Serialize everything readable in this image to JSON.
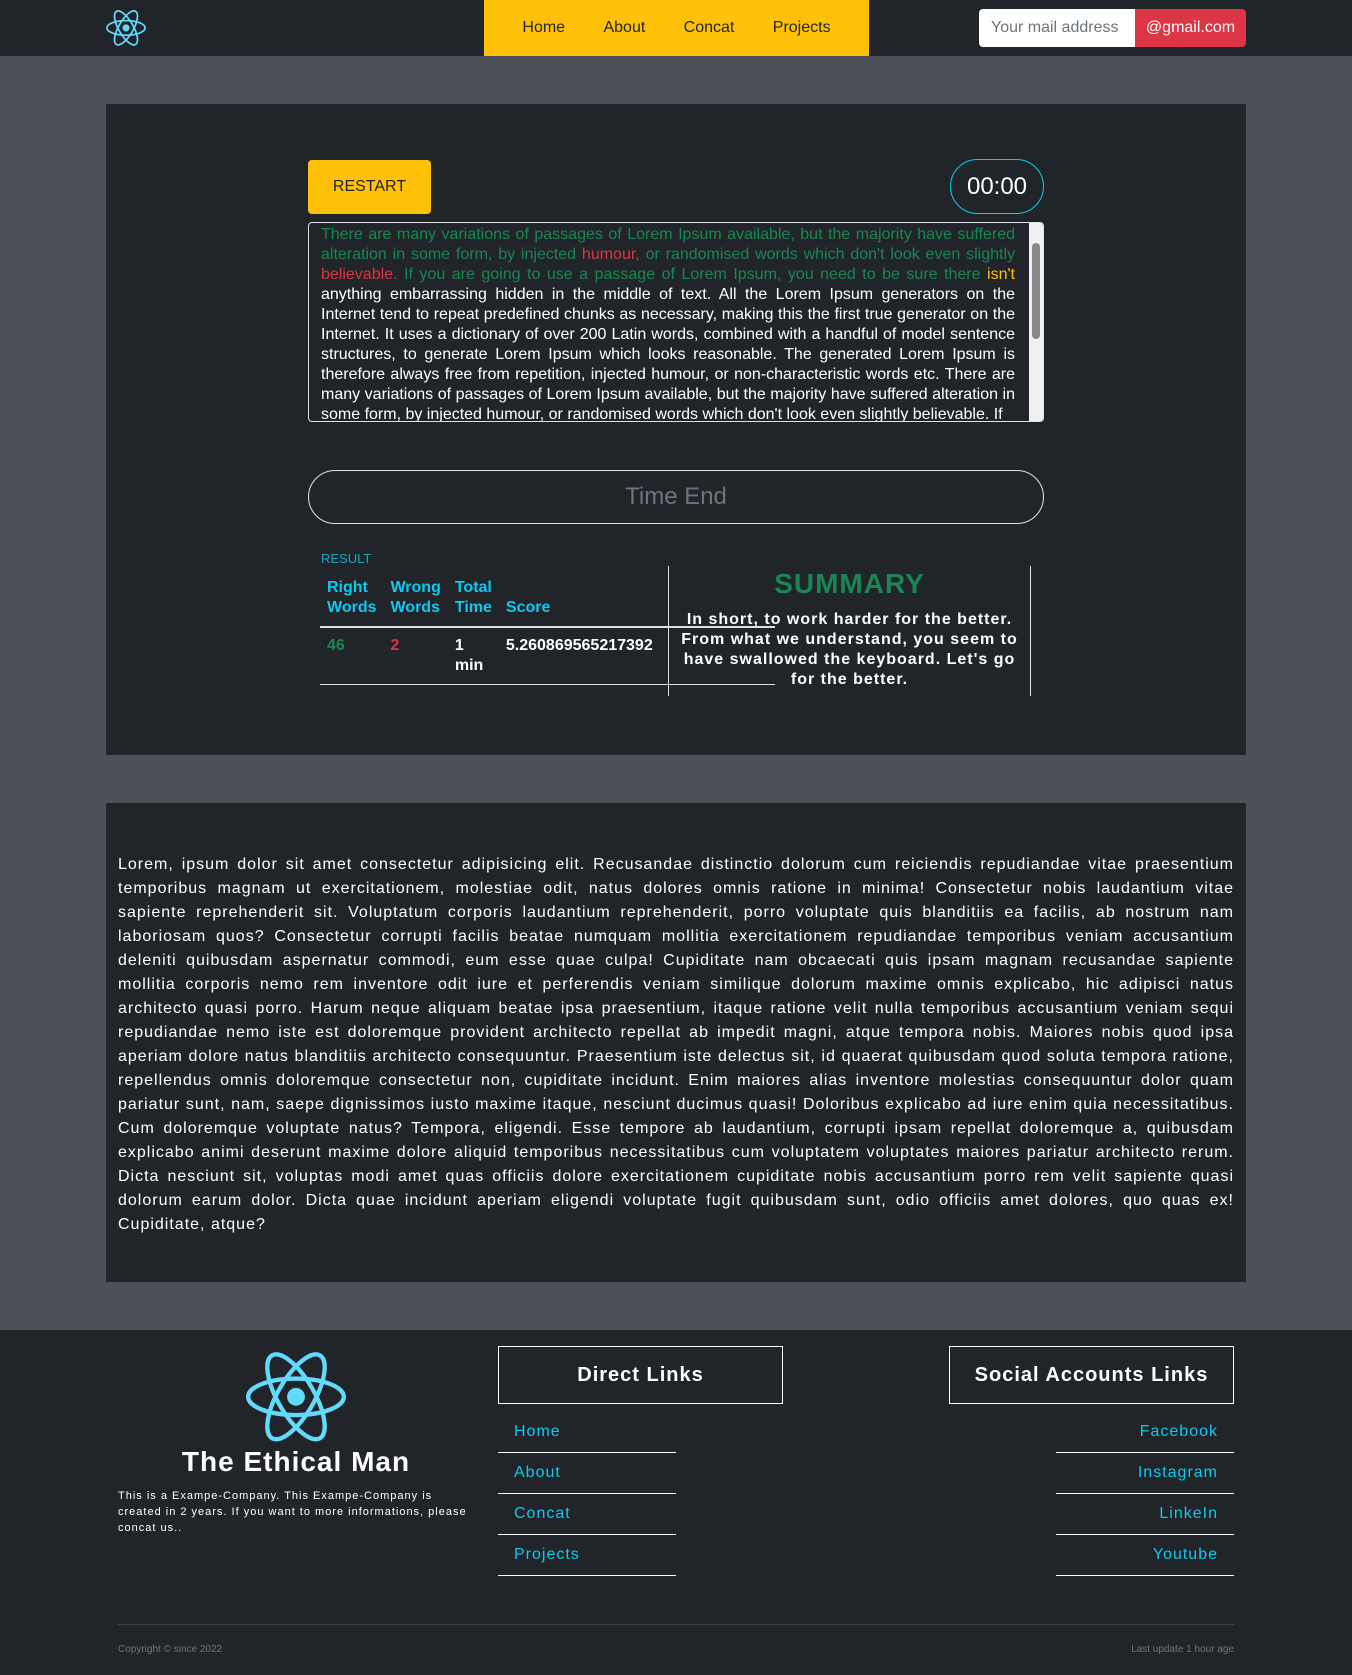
{
  "navbar": {
    "logo_icon": "react-atom-icon",
    "links": [
      "Home",
      "About",
      "Concat",
      "Projects"
    ],
    "mail_placeholder": "Your mail address",
    "mail_suffix": "@gmail.com"
  },
  "typing_test": {
    "restart_label": "RESTART",
    "timer": "00:00",
    "text_segments": {
      "typed_correct_1": "There are many variations of passages of Lorem Ipsum available, but the majority have suffered alteration in some form, by injected ",
      "typed_wrong_1": "humour,",
      "typed_correct_2": " or randomised words which don't look even slightly ",
      "typed_wrong_2": "believable.",
      "typed_correct_3": " If you are going to use a passage of Lorem Ipsum, you need to be sure there ",
      "current_word": "isn't",
      "remaining": " anything embarrassing hidden in the middle of text. All the Lorem Ipsum generators on the Internet tend to repeat predefined chunks as necessary, making this the first true generator on the Internet. It uses a dictionary of over 200 Latin words, combined with a handful of model sentence structures, to generate Lorem Ipsum which looks reasonable. The generated Lorem Ipsum is therefore always free from repetition, injected humour, or non-characteristic words etc. There are many variations of passages of Lorem Ipsum available, but the majority have suffered alteration in some form, by injected humour, or randomised words which don't look even slightly believable. If"
    },
    "input_placeholder": "Time End",
    "colors": {
      "correct": "#198754",
      "wrong": "#dc3545",
      "current": "#ffc107",
      "accent": "#0dcaf0"
    }
  },
  "result": {
    "label": "RESULT",
    "headers": {
      "right": "Right Words",
      "wrong": "Wrong Words",
      "time": "Total Time",
      "score": "Score"
    },
    "values": {
      "right": "46",
      "wrong": "2",
      "time": "1 min",
      "score": "5.260869565217392"
    }
  },
  "summary": {
    "title": "SUMMARY",
    "text": "In short, to work harder for the better. From what we understand, you seem to have swallowed the keyboard. Let's go for the better."
  },
  "lorem": {
    "text": "Lorem, ipsum dolor sit amet consectetur adipisicing elit. Recusandae distinctio dolorum cum reiciendis repudiandae vitae praesentium temporibus magnam ut exercitationem, molestiae odit, natus dolores omnis ratione in minima! Consectetur nobis laudantium vitae sapiente reprehenderit sit. Voluptatum corporis laudantium reprehenderit, porro voluptate quis blanditiis ea facilis, ab nostrum nam laboriosam quos? Consectetur corrupti facilis beatae numquam mollitia exercitationem repudiandae temporibus veniam accusantium deleniti quibusdam aspernatur commodi, eum esse quae culpa! Cupiditate nam obcaecati quis ipsam magnam recusandae sapiente mollitia corporis nemo rem inventore odit iure et perferendis veniam similique dolorum maxime omnis explicabo, hic adipisci natus architecto quasi porro. Harum neque aliquam beatae ipsa praesentium, itaque ratione velit nulla temporibus accusantium veniam sequi repudiandae nemo iste est doloremque provident architecto repellat ab impedit magni, atque tempora nobis. Maiores nobis quod ipsa aperiam dolore natus blanditiis architecto consequuntur. Praesentium iste delectus sit, id quaerat quibusdam quod soluta tempora ratione, repellendus omnis doloremque consectetur non, cupiditate incidunt. Enim maiores alias inventore molestias consequuntur dolor quam pariatur sunt, nam, saepe dignissimos iusto maxime itaque, nesciunt ducimus quasi! Doloribus explicabo ad iure enim quia necessitatibus. Cum doloremque voluptate natus? Tempora, eligendi. Esse tempore ab laudantium, corrupti ipsam repellat doloremque a, quibusdam explicabo animi deserunt maxime dolore aliquid temporibus necessitatibus cum voluptatem voluptates maiores pariatur architecto rerum. Dicta nesciunt sit, voluptas modi amet quas officiis dolore exercitationem cupiditate nobis accusantium porro rem velit sapiente quasi dolorum earum dolor. Dicta quae incidunt aperiam eligendi voluptate fugit quibusdam sunt, odio officiis amet dolores, quo quas ex! Cupiditate, atque?"
  },
  "footer": {
    "logo_icon": "react-atom-icon",
    "brand_name": "The Ethical Man",
    "brand_desc": "This is a Exampe-Company. This Exampe-Company is created in 2 years. If you want to more informations, please concat us..",
    "direct_links_title": "Direct Links",
    "direct_links": [
      "Home",
      "About",
      "Concat",
      "Projects"
    ],
    "social_title": "Social Accounts Links",
    "social_links": [
      "Facebook",
      "Instagram",
      "LinkeIn",
      "Youtube"
    ],
    "copyright": "Copyright © since 2022",
    "last_update": "Last update 1 hour age"
  }
}
